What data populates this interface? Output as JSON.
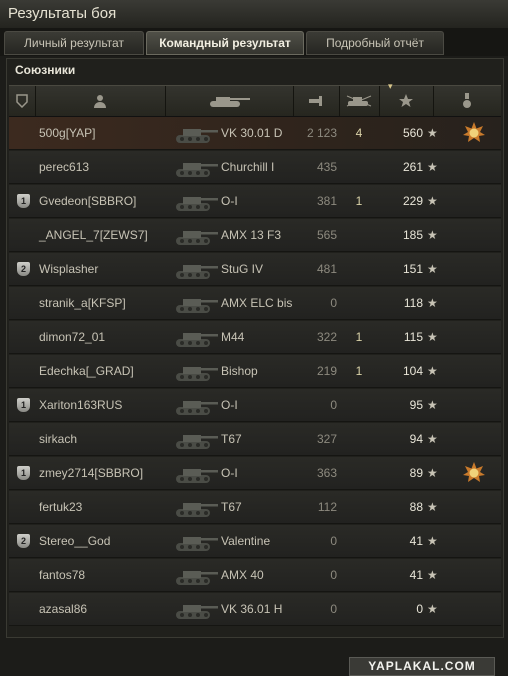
{
  "window": {
    "title": "Результаты боя"
  },
  "tabs": [
    {
      "label": "Личный результат",
      "active": false
    },
    {
      "label": "Командный результат",
      "active": true
    },
    {
      "label": "Подробный отчёт",
      "active": false
    }
  ],
  "section_title": "Союзники",
  "columns": [
    {
      "icon": "squad-icon"
    },
    {
      "icon": "player-icon"
    },
    {
      "icon": "tank-icon"
    },
    {
      "icon": "damage-icon"
    },
    {
      "icon": "frags-icon"
    },
    {
      "icon": "experience-star-icon",
      "sorted": true
    },
    {
      "icon": "medal-icon"
    }
  ],
  "rows": [
    {
      "player": "500g[YAP]",
      "vehicle": "VK 30.01 D",
      "damage": "2 123",
      "frags": "4",
      "xp": "560",
      "medal": true,
      "squad": "",
      "highlight": true
    },
    {
      "player": "perec613",
      "vehicle": "Churchill I",
      "damage": "435",
      "frags": "",
      "xp": "261",
      "medal": false,
      "squad": ""
    },
    {
      "player": "Gvedeon[SBBRO]",
      "vehicle": "O-I",
      "damage": "381",
      "frags": "1",
      "xp": "229",
      "medal": false,
      "squad": "1"
    },
    {
      "player": "_ANGEL_7[ZEWS7]",
      "vehicle": "AMX 13 F3",
      "damage": "565",
      "frags": "",
      "xp": "185",
      "medal": false,
      "squad": ""
    },
    {
      "player": "Wisplasher",
      "vehicle": "StuG IV",
      "damage": "481",
      "frags": "",
      "xp": "151",
      "medal": false,
      "squad": "2"
    },
    {
      "player": "stranik_a[KFSP]",
      "vehicle": "AMX ELC bis",
      "damage": "0",
      "frags": "",
      "xp": "118",
      "medal": false,
      "squad": ""
    },
    {
      "player": "dimon72_01",
      "vehicle": "M44",
      "damage": "322",
      "frags": "1",
      "xp": "115",
      "medal": false,
      "squad": ""
    },
    {
      "player": "Edechka[_GRAD]",
      "vehicle": "Bishop",
      "damage": "219",
      "frags": "1",
      "xp": "104",
      "medal": false,
      "squad": ""
    },
    {
      "player": "Xariton163RUS",
      "vehicle": "O-I",
      "damage": "0",
      "frags": "",
      "xp": "95",
      "medal": false,
      "squad": "1"
    },
    {
      "player": "sirkach",
      "vehicle": "T67",
      "damage": "327",
      "frags": "",
      "xp": "94",
      "medal": false,
      "squad": ""
    },
    {
      "player": "zmey2714[SBBRO]",
      "vehicle": "O-I",
      "damage": "363",
      "frags": "",
      "xp": "89",
      "medal": true,
      "squad": "1"
    },
    {
      "player": "fertuk23",
      "vehicle": "T67",
      "damage": "112",
      "frags": "",
      "xp": "88",
      "medal": false,
      "squad": ""
    },
    {
      "player": "Stereo__God",
      "vehicle": "Valentine",
      "damage": "0",
      "frags": "",
      "xp": "41",
      "medal": false,
      "squad": "2"
    },
    {
      "player": "fantos78",
      "vehicle": "AMX 40",
      "damage": "0",
      "frags": "",
      "xp": "41",
      "medal": false,
      "squad": ""
    },
    {
      "player": "azasal86",
      "vehicle": "VK 36.01 H",
      "damage": "0",
      "frags": "",
      "xp": "0",
      "medal": false,
      "squad": ""
    }
  ],
  "star_glyph": "★",
  "watermark": "YAPLAKAL.COM",
  "colors": {
    "accent": "#d9c78b",
    "highlight_row": "#3c2a1f"
  }
}
